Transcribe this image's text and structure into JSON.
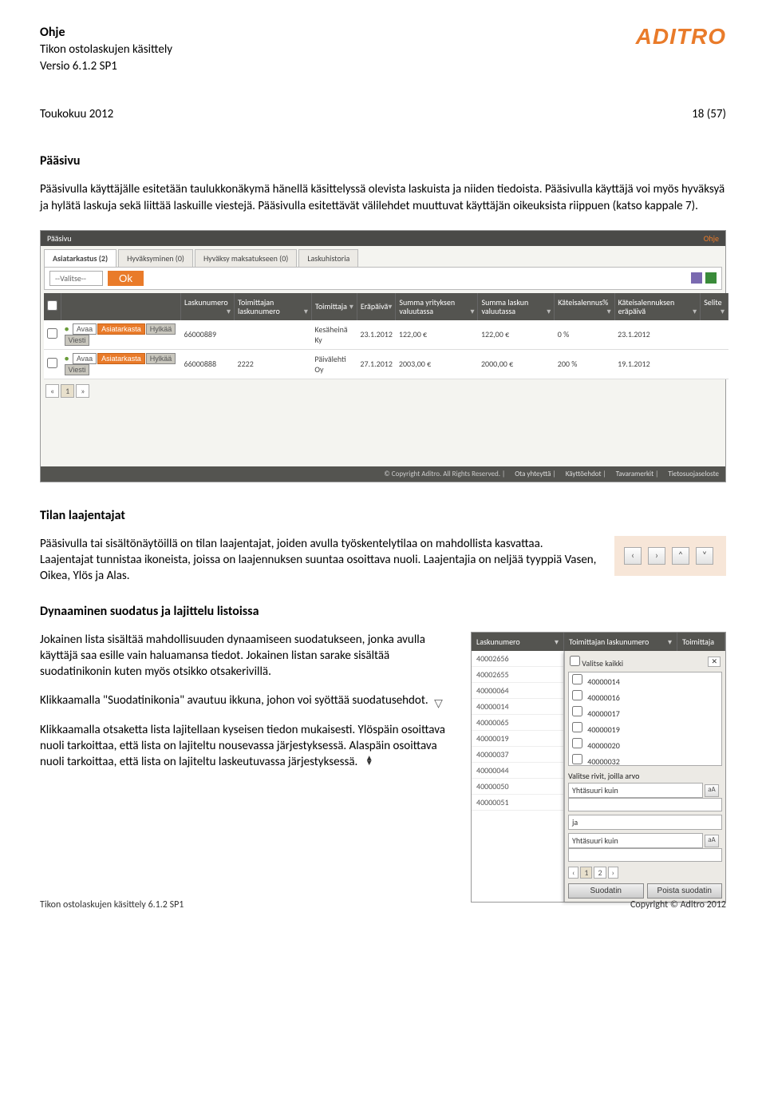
{
  "header": {
    "title": "Ohje",
    "subtitle": "Tikon ostolaskujen käsittely",
    "version": "Versio 6.1.2 SP1",
    "logo": "ADITRO"
  },
  "meta": {
    "date": "Toukokuu 2012",
    "page": "18 (57)"
  },
  "section1": {
    "heading": "Pääsivu",
    "body": "Pääsivulla käyttäjälle esitetään taulukkonäkymä hänellä käsittelyssä olevista laskuista ja niiden tiedoista. Pääsivulla käyttäjä voi myös hyväksyä ja hylätä laskuja sekä liittää laskuille viestejä. Pääsivulla esitettävät välilehdet muuttuvat käyttäjän oikeuksista riippuen (katso kappale 7)."
  },
  "shot1": {
    "topLeft": "Pääsivu",
    "topRight": "Ohje",
    "tabs": [
      "Asiatarkastus (2)",
      "Hyväksyminen (0)",
      "Hyväksy maksatukseen (0)",
      "Laskuhistoria"
    ],
    "select": "--Valitse--",
    "ok": "Ok",
    "columns": [
      "",
      "Laskunumero",
      "Toimittajan laskunumero",
      "Toimittaja",
      "Eräpäivä",
      "Summa yrityksen valuutassa",
      "Summa laskun valuutassa",
      "Käteisalennus%",
      "Käteisalennuksen eräpäivä",
      "Selite"
    ],
    "rowButtons": [
      "Avaa",
      "Asiatarkasta",
      "Hylkää",
      "Viesti"
    ],
    "rows": [
      {
        "laskunumero": "66000889",
        "toimnum": "",
        "toimittaja": "Kesäheinä Ky",
        "erapaiva": "23.1.2012",
        "summa1": "122,00 €",
        "summa2": "122,00 €",
        "alepct": "0 %",
        "alepvm": "23.1.2012",
        "selite": ""
      },
      {
        "laskunumero": "66000888",
        "toimnum": "2222",
        "toimittaja": "Päivälehti Oy",
        "erapaiva": "27.1.2012",
        "summa1": "2003,00 €",
        "summa2": "2000,00 €",
        "alepct": "200 %",
        "alepvm": "19.1.2012",
        "selite": ""
      }
    ],
    "pager": [
      "«",
      "1",
      "»"
    ],
    "footer": "© Copyright Aditro. All Rights Reserved.",
    "footerLinks": [
      "Ota yhteyttä",
      "Käyttöehdot",
      "Tavaramerkit",
      "Tietosuojaseloste"
    ]
  },
  "section2": {
    "heading": "Tilan laajentajat",
    "body": "Pääsivulla tai sisältönäytöillä on tilan laajentajat, joiden avulla työskentelytilaa on mahdollista kasvattaa. Laajentajat tunnistaa ikoneista, joissa on laajennuksen suuntaa osoittava nuoli. Laajentajia on neljää tyyppiä Vasen, Oikea, Ylös ja Alas."
  },
  "expander": {
    "glyphs": [
      "‹",
      "›",
      "˄",
      "˅"
    ]
  },
  "section3": {
    "heading": "Dynaaminen suodatus ja lajittelu listoissa",
    "p1": "Jokainen lista sisältää mahdollisuuden dynaamiseen suodatukseen, jonka avulla käyttäjä saa esille vain haluamansa tiedot. Jokainen listan sarake sisältää suodatinikonin kuten myös otsikko otsakerivillä.",
    "p2": "Klikkaamalla \"Suodatinikonia\" avautuu ikkuna, johon voi syöttää suodatusehdot.",
    "p3": "Klikkaamalla otsaketta lista lajitellaan kyseisen tiedon mukaisesti. Ylöspäin osoittava nuoli tarkoittaa, että lista on lajiteltu nousevassa järjestyksessä. Alaspäin osoittava nuoli tarkoittaa, että lista on lajiteltu laskeutuvassa järjestyksessä."
  },
  "shot2": {
    "hdrCols": [
      "Laskunumero",
      "Toimittajan laskunumero",
      "Toimittaja"
    ],
    "list": [
      "40002656",
      "40002655",
      "40000064",
      "40000014",
      "40000065",
      "40000019",
      "40000037",
      "40000044",
      "40000050",
      "40000051"
    ],
    "valitseKaikki": "Valitse kaikki",
    "options": [
      "40000014",
      "40000016",
      "40000017",
      "40000019",
      "40000020",
      "40000032"
    ],
    "row1Label": "Valitse rivit, joilla arvo",
    "sel1": "Yhtäsuuri kuin",
    "ja": "ja",
    "sel2": "Yhtäsuuri kuin",
    "aA": "aA",
    "pager": [
      "‹",
      "1",
      "2",
      "›"
    ],
    "btn1": "Suodatin",
    "btn2": "Poista suodatin"
  },
  "footer": {
    "left": "Tikon ostolaskujen käsittely 6.1.2 SP1",
    "right": "Copyright © Aditro 2012"
  }
}
